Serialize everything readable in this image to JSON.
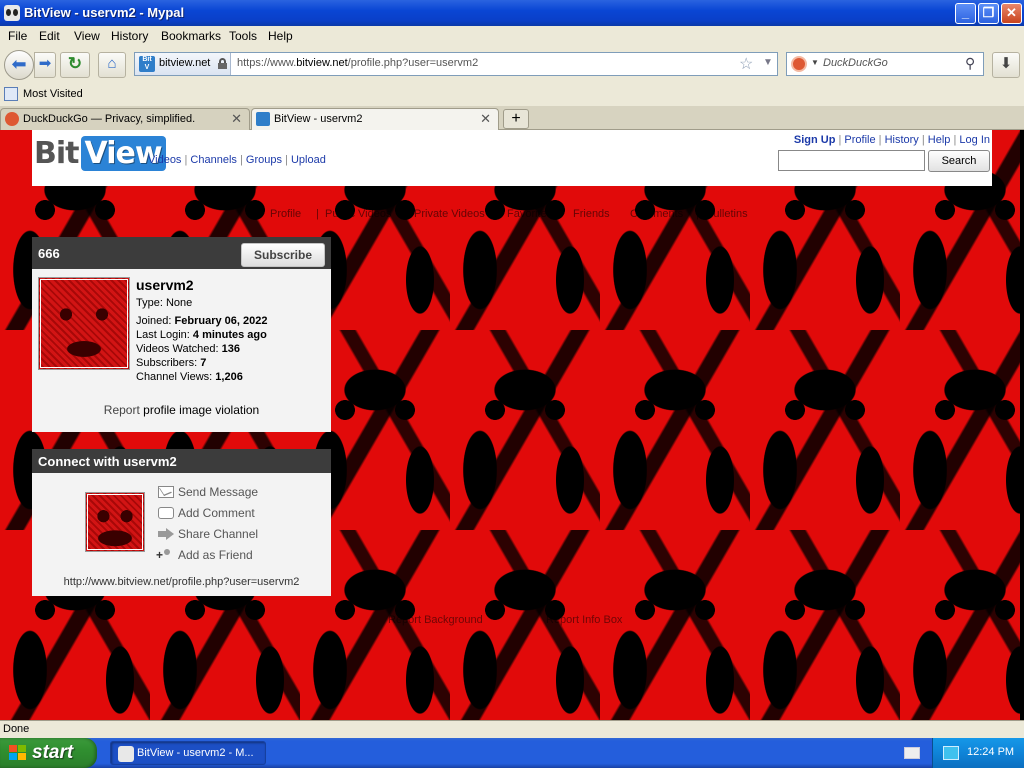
{
  "window": {
    "title": "BitView - uservm2 - Mypal",
    "buttons": {
      "minimize": "_",
      "maximize": "❐",
      "close": "✕"
    }
  },
  "menu": [
    "File",
    "Edit",
    "View",
    "History",
    "Bookmarks",
    "Tools",
    "Help"
  ],
  "nav": {
    "site_label": "bitview.net",
    "url_prefix": "https://www.",
    "url_domain": "bitview.net",
    "url_suffix": "/profile.php?user=uservm2",
    "search_placeholder": "DuckDuckGo"
  },
  "bookmarks": {
    "most_visited": "Most Visited"
  },
  "tabs": [
    {
      "title": "DuckDuckGo — Privacy, simplified.",
      "active": false
    },
    {
      "title": "BitView - uservm2",
      "active": true
    }
  ],
  "site": {
    "logo_bit": "Bit",
    "logo_view": "View",
    "nav": [
      "Videos",
      "Channels",
      "Groups",
      "Upload"
    ],
    "top_links": [
      "Sign Up",
      "Profile",
      "History",
      "Help",
      "Log In"
    ],
    "search_button": "Search",
    "subnav": [
      "Profile",
      "Public Videos",
      "Private Videos",
      "Favorites",
      "Friends",
      "Comments",
      "Bulletins"
    ],
    "footer_links": [
      "Report Background",
      "Report Info Box"
    ]
  },
  "profile": {
    "header": "666",
    "subscribe": "Subscribe",
    "username": "uservm2",
    "type_label": "Type:",
    "type_value": "None",
    "joined_label": "Joined:",
    "joined_value": "February 06, 2022",
    "last_login_label": "Last Login:",
    "last_login_value": "4 minutes ago",
    "videos_watched_label": "Videos Watched:",
    "videos_watched_value": "136",
    "subscribers_label": "Subscribers:",
    "subscribers_value": "7",
    "channel_views_label": "Channel Views:",
    "channel_views_value": "1,206",
    "report_prefix": "Report",
    "report_rest": "profile image violation"
  },
  "connect": {
    "header": "Connect with uservm2",
    "actions": [
      "Send Message",
      "Add Comment",
      "Share Channel",
      "Add as Friend"
    ],
    "channel_url": "http://www.bitview.net/profile.php?user=uservm2"
  },
  "status": "Done",
  "taskbar": {
    "start": "start",
    "item": "BitView - uservm2 - M...",
    "clock": "12:24 PM"
  },
  "colors": {
    "page_background": "#e10a0a",
    "link": "#1c3aa9",
    "logo_accent": "#2b83d6",
    "box_header": "#3c3c3c"
  }
}
